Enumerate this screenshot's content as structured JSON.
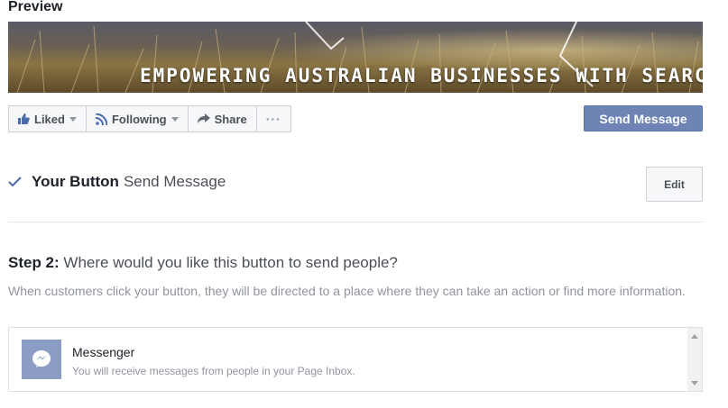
{
  "preview": {
    "title": "Preview"
  },
  "cover": {
    "text": "EMPOWERING AUSTRALIAN BUSINESSES WITH SEARCH MARKET"
  },
  "actions": {
    "liked_label": "Liked",
    "following_label": "Following",
    "share_label": "Share",
    "more_label": "···"
  },
  "send_message_label": "Send Message",
  "your_button": {
    "label": "Your Button",
    "value": "Send Message",
    "edit_label": "Edit"
  },
  "step2": {
    "number": "Step 2:",
    "question": "Where would you like this button to send people?",
    "description": "When customers click your button, they will be directed to a place where they can take an action or find more information."
  },
  "option": {
    "title": "Messenger",
    "description": "You will receive messages from people in your Page Inbox."
  },
  "icons": {
    "liked": "thumbs-up-icon",
    "following": "rss-icon",
    "share": "share-arrow-icon",
    "check": "check-icon",
    "messenger": "messenger-icon"
  },
  "colors": {
    "primary_button": "#6d84b4",
    "messenger_tile": "#8b9dc3",
    "check": "#4b6aa8"
  }
}
